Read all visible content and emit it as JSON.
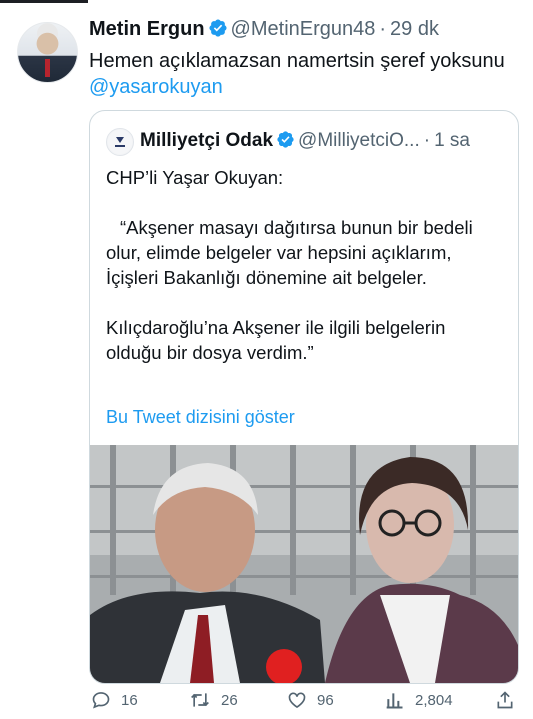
{
  "tweet": {
    "author_name": "Metin Ergun",
    "author_handle": "@MetinErgun48",
    "separator": "·",
    "time": "29 dk",
    "text": "Hemen açıklamazsan namertsin şeref yoksunu",
    "mention": "@yasarokuyan"
  },
  "quoted_tweet": {
    "author_name": "Milliyetçi Odak",
    "author_handle": "@MilliyetciO...",
    "separator": "·",
    "time": "1 sa",
    "avatar_label": "Milliyetçi Odak",
    "paragraphs": [
      "CHP’li Yaşar Okuyan:",
      "“Akşener masayı dağıtırsa bunun bir bedeli olur, elimde belgeler var hepsini açıklarım, İçişleri Bakanlığı dönemine ait belgeler.",
      "Kılıçdaroğlu’na Akşener ile ilgili belgelerin olduğu bir dosya verdim.”"
    ],
    "show_thread_label": "Bu Tweet dizisini göster"
  },
  "actions": {
    "replies": "16",
    "retweets": "26",
    "likes": "96",
    "views": "2,804"
  },
  "colors": {
    "accent": "#1d9bf0",
    "secondary_text": "#536471",
    "border": "#cfd9de"
  },
  "icons": [
    "verified-badge-icon",
    "reply-icon",
    "retweet-icon",
    "like-icon",
    "views-icon",
    "share-icon"
  ]
}
